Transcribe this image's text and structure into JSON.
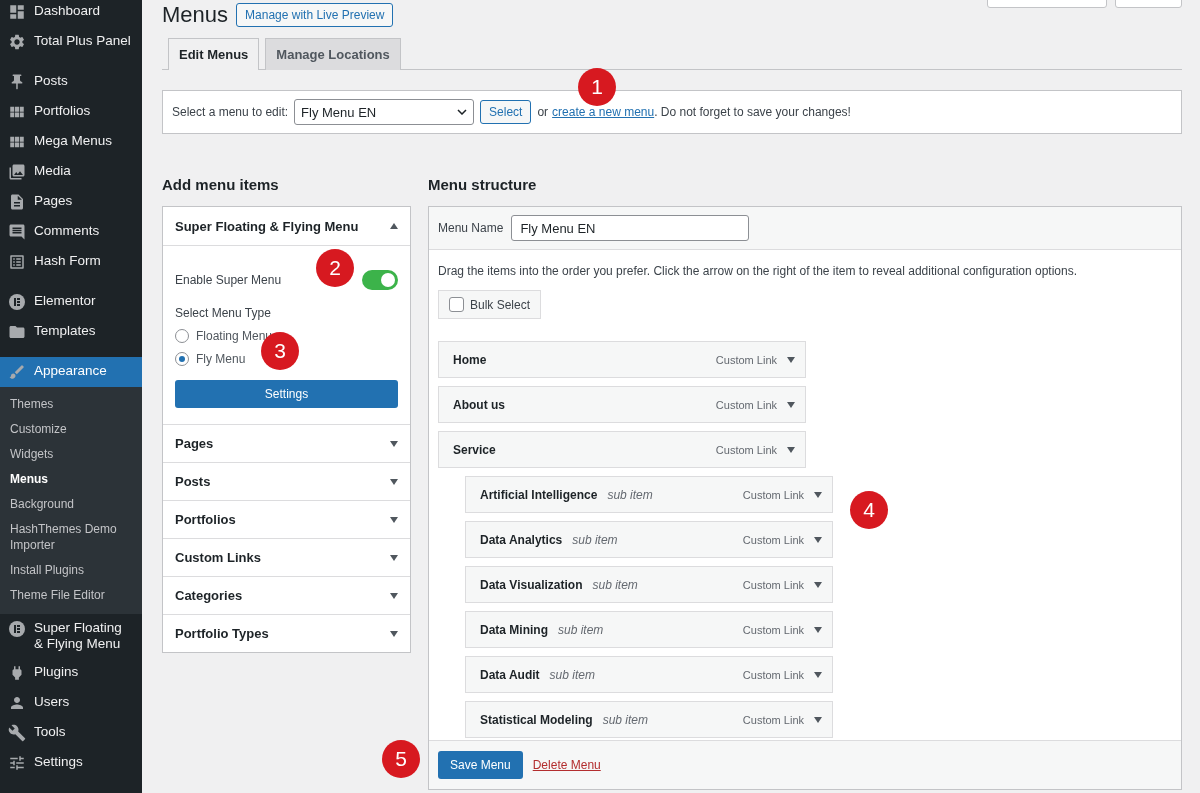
{
  "sidebar": {
    "groups": [
      [
        {
          "label": "Dashboard",
          "selected": false
        },
        {
          "label": "Total Plus Panel",
          "selected": false
        }
      ],
      [
        {
          "label": "Posts",
          "selected": false
        },
        {
          "label": "Portfolios",
          "selected": false
        },
        {
          "label": "Mega Menus",
          "selected": false
        },
        {
          "label": "Media",
          "selected": false
        },
        {
          "label": "Pages",
          "selected": false
        },
        {
          "label": "Comments",
          "selected": false
        },
        {
          "label": "Hash Form",
          "selected": false
        }
      ],
      [
        {
          "label": "Elementor",
          "selected": false
        },
        {
          "label": "Templates",
          "selected": false
        }
      ],
      [
        {
          "label": "Appearance",
          "selected": true,
          "children": [
            {
              "label": "Themes",
              "selected": false
            },
            {
              "label": "Customize",
              "selected": false
            },
            {
              "label": "Widgets",
              "selected": false
            },
            {
              "label": "Menus",
              "selected": true
            },
            {
              "label": "Background",
              "selected": false
            },
            {
              "label": "HashThemes Demo Importer",
              "selected": false
            },
            {
              "label": "Install Plugins",
              "selected": false
            },
            {
              "label": "Theme File Editor",
              "selected": false
            }
          ]
        },
        {
          "label": "Super Floating & Flying Menu",
          "selected": false
        },
        {
          "label": "Plugins",
          "selected": false
        },
        {
          "label": "Users",
          "selected": false
        },
        {
          "label": "Tools",
          "selected": false
        },
        {
          "label": "Settings",
          "selected": false
        }
      ]
    ]
  },
  "page": {
    "title": "Menus",
    "live_preview_button": "Manage with Live Preview"
  },
  "tabs": [
    {
      "label": "Edit Menus",
      "selected": true
    },
    {
      "label": "Manage Locations",
      "selected": false
    }
  ],
  "select_bar": {
    "label": "Select a menu to edit:",
    "value": "Fly Menu EN",
    "button": "Select",
    "or_text": "or",
    "link": "create a new menu",
    "suffix": ". Do not forget to save your changes!"
  },
  "add_items": {
    "heading": "Add menu items",
    "sections": [
      {
        "title": "Super Floating & Flying Menu",
        "expanded": true,
        "enable_label": "Enable Super Menu",
        "enabled": true,
        "type_label": "Select Menu Type",
        "options": [
          {
            "label": "Floating Menu",
            "selected": false
          },
          {
            "label": "Fly Menu",
            "selected": true
          }
        ],
        "button": "Settings"
      },
      {
        "title": "Pages",
        "expanded": false
      },
      {
        "title": "Posts",
        "expanded": false
      },
      {
        "title": "Portfolios",
        "expanded": false
      },
      {
        "title": "Custom Links",
        "expanded": false
      },
      {
        "title": "Categories",
        "expanded": false
      },
      {
        "title": "Portfolio Types",
        "expanded": false
      }
    ]
  },
  "structure": {
    "heading": "Menu structure",
    "name_label": "Menu Name",
    "name_value": "Fly Menu EN",
    "instructions": "Drag the items into the order you prefer. Click the arrow on the right of the item to reveal additional configuration options.",
    "bulk_select": {
      "label": "Bulk Select",
      "checked": false
    },
    "items": [
      {
        "title": "Home",
        "type": "Custom Link"
      },
      {
        "title": "About us",
        "type": "Custom Link"
      },
      {
        "title": "Service",
        "type": "Custom Link",
        "children": [
          {
            "title": "Artificial Intelligence",
            "note": "sub item",
            "type": "Custom Link"
          },
          {
            "title": "Data Analytics",
            "note": "sub item",
            "type": "Custom Link"
          },
          {
            "title": "Data Visualization",
            "note": "sub item",
            "type": "Custom Link"
          },
          {
            "title": "Data Mining",
            "note": "sub item",
            "type": "Custom Link"
          },
          {
            "title": "Data Audit",
            "note": "sub item",
            "type": "Custom Link"
          },
          {
            "title": "Statistical Modeling",
            "note": "sub item",
            "type": "Custom Link"
          }
        ]
      }
    ],
    "save_button": "Save Menu",
    "delete_link": "Delete Menu"
  },
  "callouts": [
    {
      "label": "1"
    },
    {
      "label": "2"
    },
    {
      "label": "3"
    },
    {
      "label": "4"
    },
    {
      "label": "5"
    }
  ]
}
